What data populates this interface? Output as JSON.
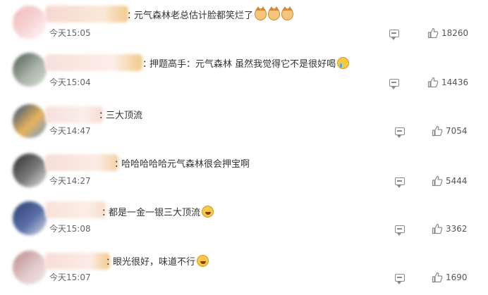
{
  "comments": [
    {
      "text": "元气森林老总估计脸都笑烂了",
      "emojis": [
        "cat-emoji",
        "cat-emoji",
        "cat-emoji"
      ],
      "time": "今天15:05",
      "likes": "18260",
      "avatar_colors": [
        "#f3b9b9",
        "#f7d6d6",
        "#ffffff"
      ],
      "name_colors": [
        "#f6d8d2",
        "#f9e9d6",
        "#f3c98a"
      ]
    },
    {
      "text": "押题高手：元气森林 虽然我觉得它不是很好喝",
      "emojis": [
        "crying-emoji"
      ],
      "time": "今天15:04",
      "likes": "14436",
      "avatar_colors": [
        "#4e5a50",
        "#a9b3a8",
        "#d6ddd7"
      ],
      "name_colors": [
        "#f8e0db",
        "#fbeee6",
        "#f2c98a"
      ]
    },
    {
      "text": "三大顶流",
      "emojis": [],
      "time": "今天14:47",
      "likes": "7054",
      "avatar_colors": [
        "#2a4d7a",
        "#e9b35a",
        "#6a9ac9"
      ],
      "name_colors": [
        "#f6e0dc",
        "#fbeee8",
        "#f6d9cf"
      ]
    },
    {
      "text": "哈哈哈哈哈元气森林很会押宝啊",
      "emojis": [],
      "time": "今天14:27",
      "likes": "5444",
      "avatar_colors": [
        "#2c2c2c",
        "#7a7a7a",
        "#e3e3e3"
      ],
      "name_colors": [
        "#f7ddd8",
        "#fbece4",
        "#f3d1a6"
      ]
    },
    {
      "text": "都是一金一银三大顶流",
      "emojis": [
        "laughing-emoji"
      ],
      "time": "今天15:08",
      "likes": "3362",
      "avatar_colors": [
        "#2a3f73",
        "#5a6fa6",
        "#d9dde9"
      ],
      "name_colors": [
        "#f9e1d9",
        "#fbede5",
        "#f7dcc9"
      ]
    },
    {
      "text": "眼光很好，味道不行",
      "emojis": [
        "laughing-emoji"
      ],
      "time": "今天15:07",
      "likes": "1690",
      "avatar_colors": [
        "#b88a8a",
        "#e2c9c9",
        "#f4ecec"
      ],
      "name_colors": [
        "#f8ddd7",
        "#fbece5",
        "#f2c98a"
      ]
    }
  ]
}
